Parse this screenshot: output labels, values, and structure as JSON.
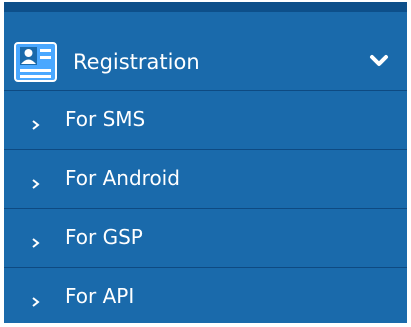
{
  "menu": {
    "header": {
      "label": "Registration",
      "icon": "id-card-icon",
      "toggle_icon": "chevron-down-icon"
    },
    "items": [
      {
        "label": "For SMS"
      },
      {
        "label": "For Android"
      },
      {
        "label": "For GSP"
      },
      {
        "label": "For API"
      }
    ],
    "colors": {
      "background": "#1a6aab",
      "top_border": "#0d4f8a",
      "divider": "#0e4a82",
      "text": "#ffffff",
      "icon_fill": "#4aa8ff"
    }
  }
}
